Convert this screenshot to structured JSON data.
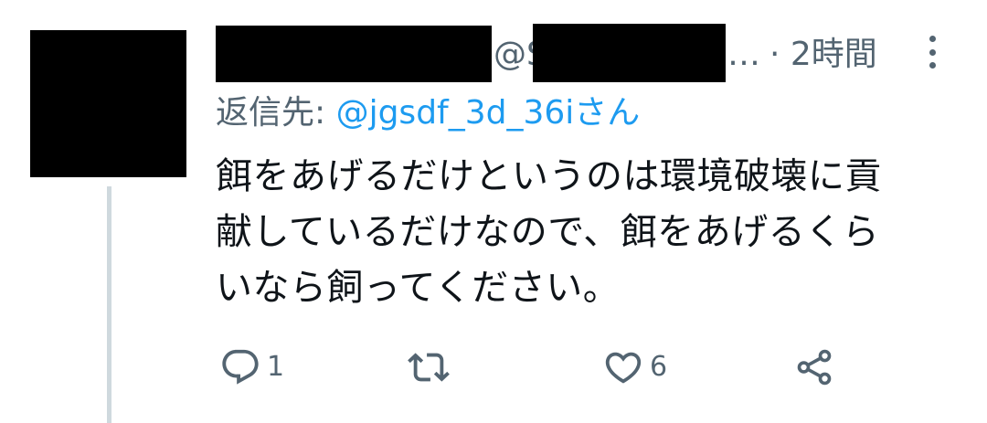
{
  "tweet": {
    "handle_prefix": "@S",
    "handle_ellipsis": "…",
    "separator_time": "· 2時間",
    "reply_to_label": "返信先: ",
    "reply_to_mention": "@jgsdf_3d_36iさん",
    "text_lines": [
      "餌をあげるだけというのは環境破壊に貢",
      "献しているだけなので、餌をあげるくら",
      "いなら飼ってください。"
    ]
  },
  "actions": {
    "reply": {
      "icon": "reply-icon",
      "count": "1"
    },
    "retweet": {
      "icon": "retweet-icon",
      "count": ""
    },
    "like": {
      "icon": "heart-icon",
      "count": "6"
    },
    "share": {
      "icon": "share-icon"
    }
  },
  "colors": {
    "text": "#0f1419",
    "secondary": "#536471",
    "link": "#1d9bf0",
    "thread_line": "#cfd9de"
  }
}
